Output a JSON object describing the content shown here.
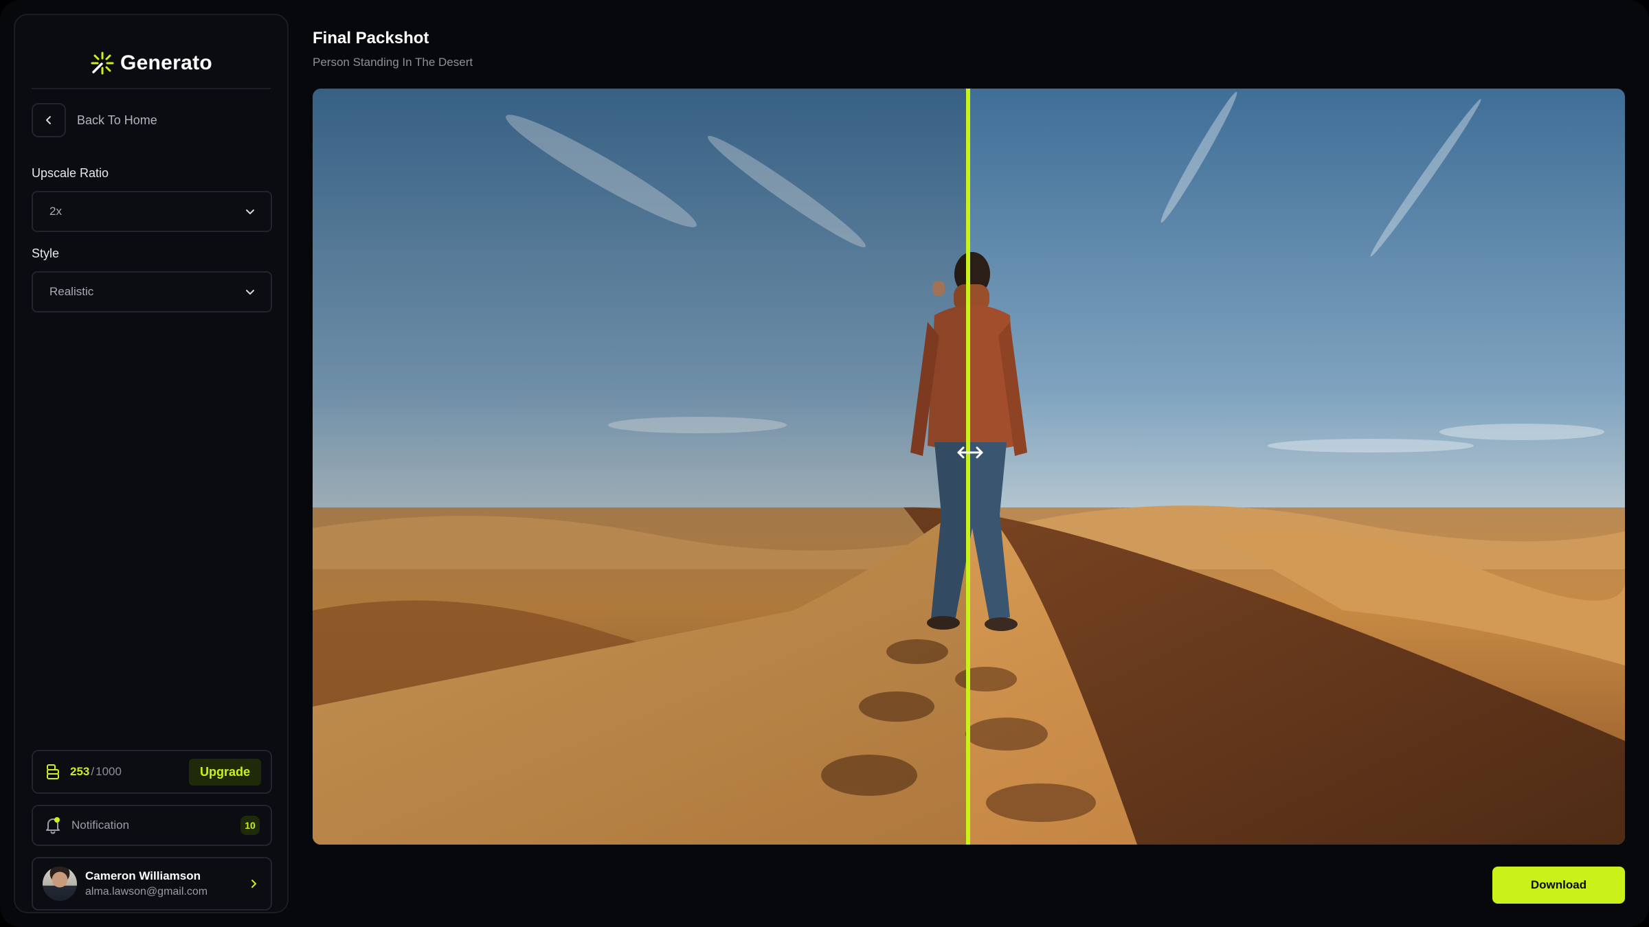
{
  "app": {
    "brand": "Generato",
    "accent_color": "#c8f21a"
  },
  "sidebar": {
    "back_label": "Back To Home",
    "upscale_ratio": {
      "label": "Upscale Ratio",
      "value": "2x"
    },
    "style": {
      "label": "Style",
      "value": "Realistic"
    },
    "credits": {
      "used": "253",
      "separator": "/",
      "total": "1000",
      "upgrade_label": "Upgrade"
    },
    "notification": {
      "label": "Notification",
      "count": "10"
    },
    "user": {
      "name": "Cameron Williamson",
      "email": "alma.lawson@gmail.com"
    }
  },
  "main": {
    "title": "Final Packshot",
    "subtitle": "Person Standing In The Desert",
    "comparison": {
      "split_fraction": 0.498,
      "handle_icon": "left-right-arrow-icon"
    },
    "download_label": "Download"
  }
}
